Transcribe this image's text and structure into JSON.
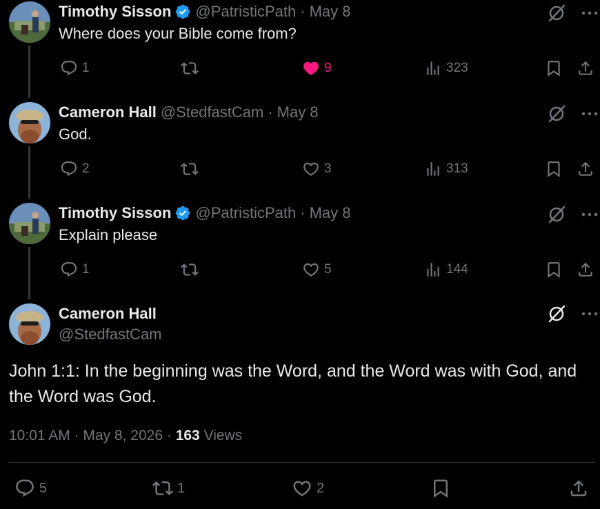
{
  "tweets": [
    {
      "name": "Timothy Sisson",
      "verified": true,
      "handle": "@PatristicPath",
      "dot": "·",
      "date": "May 8",
      "text": "Where does your Bible come from?",
      "replies": "1",
      "retweets": "",
      "likes": "9",
      "liked": true,
      "views": "323"
    },
    {
      "name": "Cameron Hall",
      "verified": false,
      "handle": "@StedfastCam",
      "dot": "·",
      "date": "May 8",
      "text": "God.",
      "replies": "2",
      "retweets": "",
      "likes": "3",
      "liked": false,
      "views": "313"
    },
    {
      "name": "Timothy Sisson",
      "verified": true,
      "handle": "@PatristicPath",
      "dot": "·",
      "date": "May 8",
      "text": "Explain please",
      "replies": "1",
      "retweets": "",
      "likes": "5",
      "liked": false,
      "views": "144"
    }
  ],
  "main": {
    "name": "Cameron Hall",
    "handle": "@StedfastCam",
    "text_line1": "John 1:1: In the beginning was the Word, and the Word was with God, and",
    "text_line2": "the Word was God.",
    "time": "10:01 AM",
    "sep1": "·",
    "date": "May 8, 2026",
    "sep2": "·",
    "views_count": "163",
    "views_label": "Views",
    "replies": "5",
    "retweets": "1",
    "likes": "2"
  },
  "colors": {
    "background": "#000000",
    "text": "#e7e9ea",
    "muted": "#71767b",
    "like": "#f91880",
    "verified": "#1d9bf0",
    "divider": "#2f3336"
  },
  "icons": [
    "reply-icon",
    "retweet-icon",
    "heart-icon",
    "views-icon",
    "bookmark-icon",
    "share-icon",
    "grok-icon",
    "more-icon",
    "verified-badge-icon"
  ]
}
